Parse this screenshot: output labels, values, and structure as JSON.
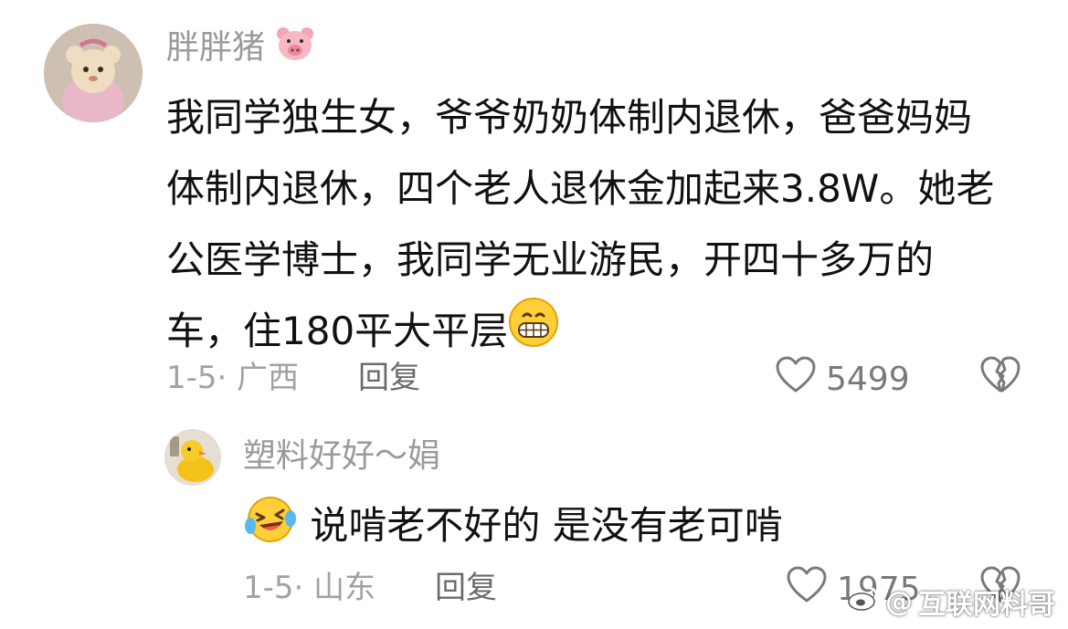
{
  "comment": {
    "username": "胖胖猪",
    "username_emoji_icon": "pig-face-icon",
    "text_lines": [
      "我同学独生女，爷爷奶奶体制内退休，爸爸妈妈",
      "体制内退休，四个老人退休金加起来3.8W。她老",
      "公医学博士，我同学无业游民，开四十多万的",
      "车，住180平大平层"
    ],
    "trailing_emoji_icon": "grinning-face-icon",
    "date_location": "1-5· 广西",
    "reply_label": "回复",
    "like_count": "5499"
  },
  "reply": {
    "username": "塑料好好～娟",
    "leading_emoji_icon": "laughing-tears-face-icon",
    "text": "说啃老不好的 是没有老可啃",
    "date_location": "1-5· 山东",
    "reply_label": "回复",
    "like_count": "1975"
  },
  "watermark": {
    "prefix": "@",
    "text": "互联网料哥",
    "icon": "weibo-logo-icon"
  },
  "colors": {
    "text": "#111111",
    "muted": "#9a9a9a",
    "icon": "#7a7a7a"
  }
}
